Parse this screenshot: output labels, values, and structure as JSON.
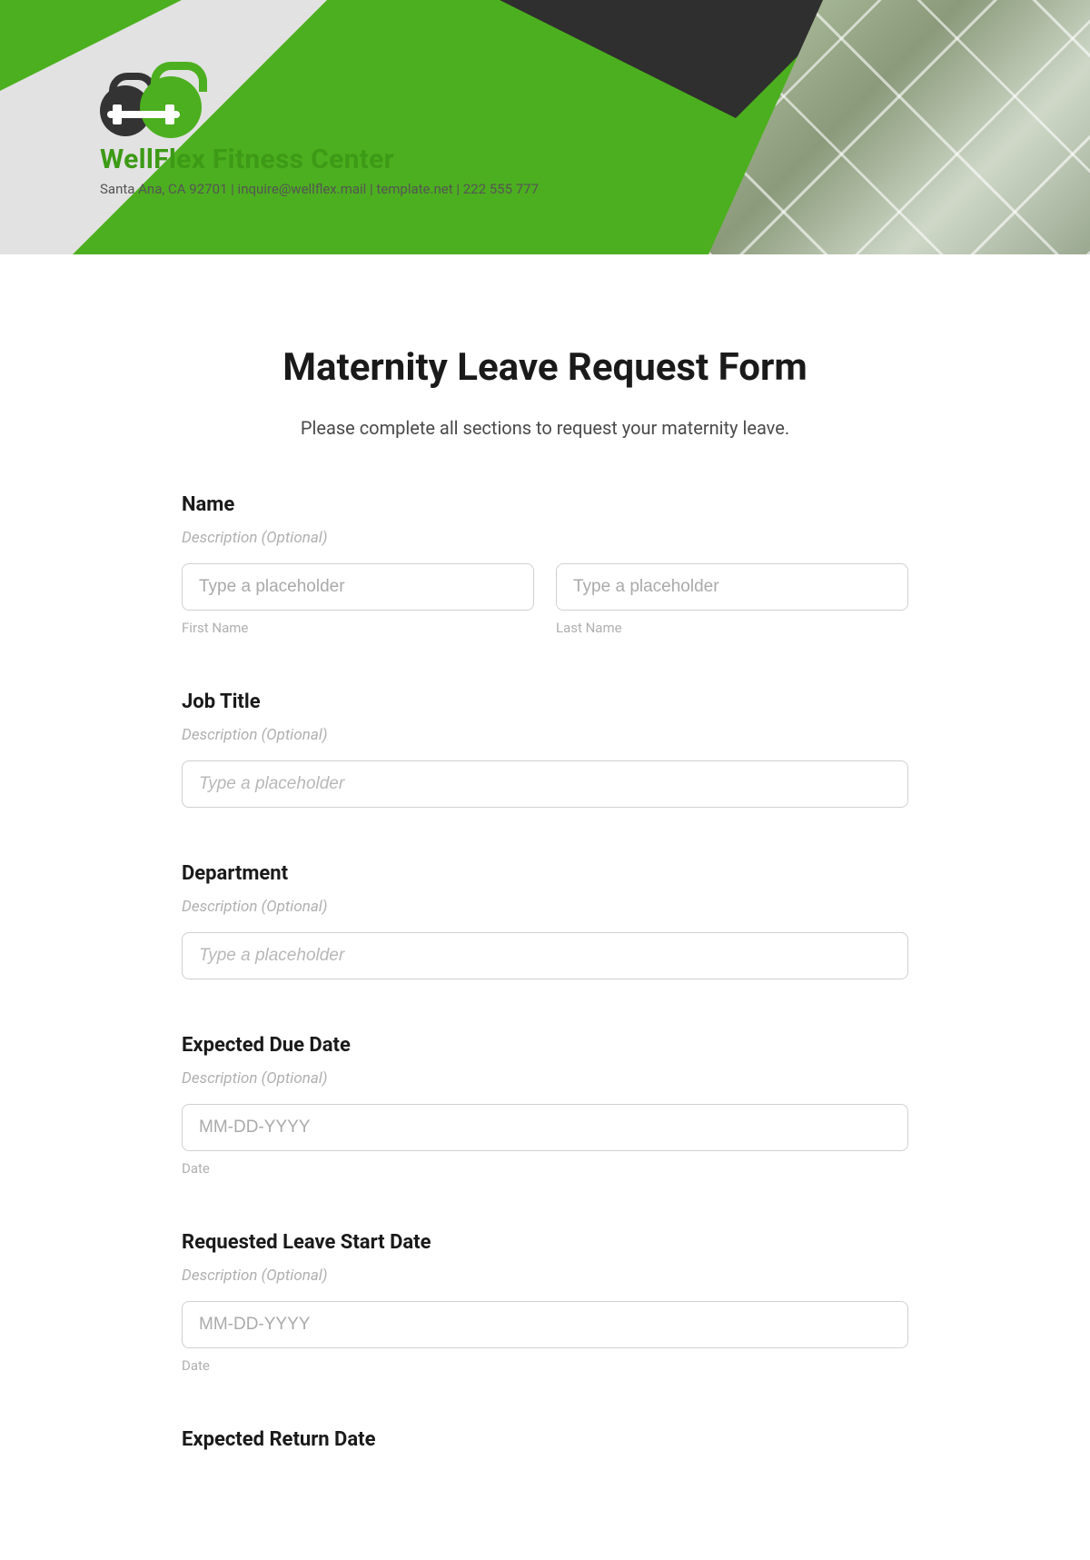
{
  "header": {
    "brand": "WellFlex Fitness Center",
    "tagline": "Santa Ana, CA 92701 | inquire@wellflex.mail | template.net | 222 555 777"
  },
  "form": {
    "title": "Maternity Leave Request Form",
    "subtitle": "Please complete all sections to request your maternity leave.",
    "description_placeholder": "Description (Optional)",
    "generic_placeholder": "Type a placeholder",
    "date_placeholder": "MM-DD-YYYY",
    "date_sublabel": "Date",
    "fields": {
      "name": {
        "label": "Name",
        "first_sublabel": "First Name",
        "last_sublabel": "Last Name"
      },
      "job_title": {
        "label": "Job Title"
      },
      "department": {
        "label": "Department"
      },
      "due_date": {
        "label": "Expected Due Date"
      },
      "start_date": {
        "label": "Requested Leave Start Date"
      },
      "return_date": {
        "label": "Expected Return Date"
      }
    }
  }
}
